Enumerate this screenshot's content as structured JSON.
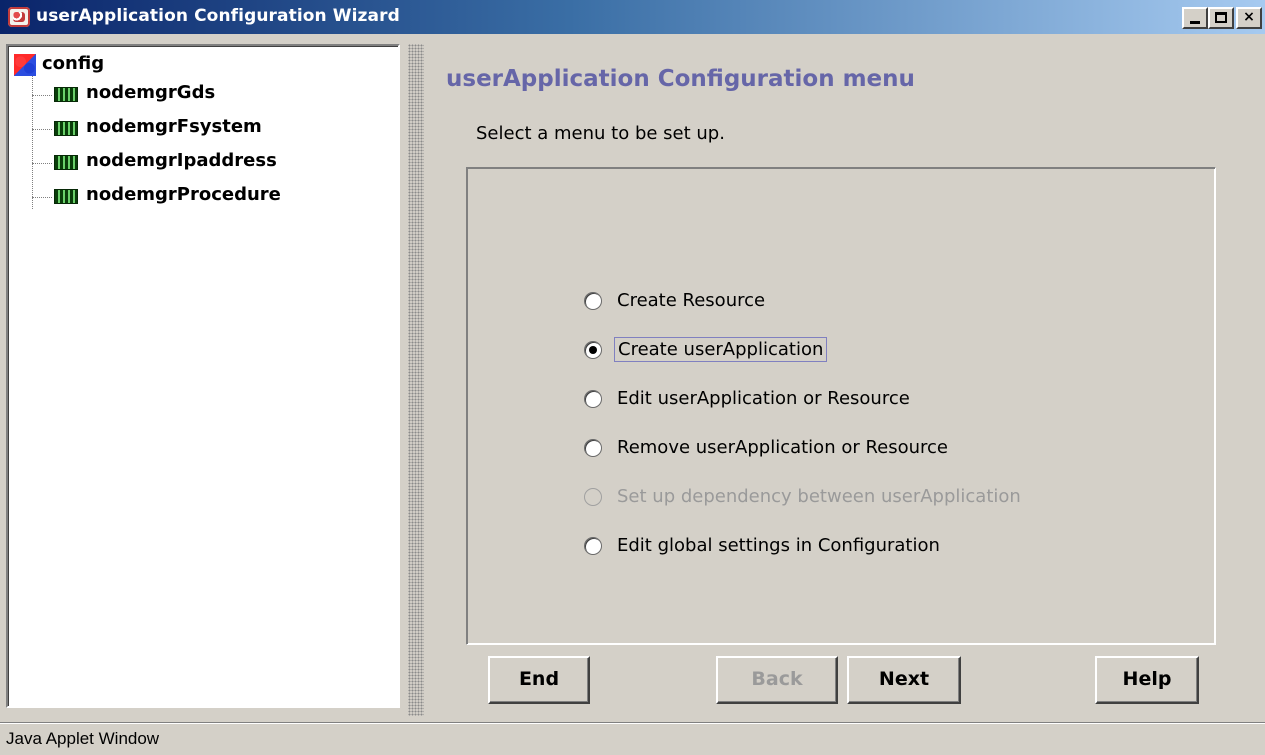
{
  "window": {
    "title": "userApplication Configuration Wizard",
    "controls": [
      "minimize-icon",
      "maximize-icon",
      "close-icon"
    ],
    "close_glyph": "×"
  },
  "tree": {
    "root": {
      "label": "config",
      "icon": "config-icon"
    },
    "nodes": [
      {
        "label": "nodemgrGds",
        "icon": "resource-icon"
      },
      {
        "label": "nodemgrFsystem",
        "icon": "resource-icon"
      },
      {
        "label": "nodemgrIpaddress",
        "icon": "resource-icon"
      },
      {
        "label": "nodemgrProcedure",
        "icon": "resource-icon"
      }
    ]
  },
  "main": {
    "heading": "userApplication Configuration menu",
    "instruction": "Select a menu to be set up.",
    "options": [
      {
        "label": "Create Resource",
        "selected": false,
        "enabled": true
      },
      {
        "label": "Create userApplication",
        "selected": true,
        "enabled": true
      },
      {
        "label": "Edit userApplication or Resource",
        "selected": false,
        "enabled": true
      },
      {
        "label": "Remove userApplication or Resource",
        "selected": false,
        "enabled": true
      },
      {
        "label": "Set up dependency between userApplication",
        "selected": false,
        "enabled": false
      },
      {
        "label": "Edit global settings in Configuration",
        "selected": false,
        "enabled": true
      }
    ]
  },
  "buttons": {
    "end": {
      "label": "End",
      "enabled": true
    },
    "back": {
      "label": "Back",
      "enabled": false
    },
    "next": {
      "label": "Next",
      "enabled": true
    },
    "help": {
      "label": "Help",
      "enabled": true
    }
  },
  "status": {
    "text": "Java Applet Window"
  },
  "colors": {
    "titlebar_start": "#0a246a",
    "titlebar_end": "#a6caf0",
    "heading": "#6666a8",
    "window_bg": "#d4d0c8",
    "disabled_text": "#9a9a9a"
  }
}
